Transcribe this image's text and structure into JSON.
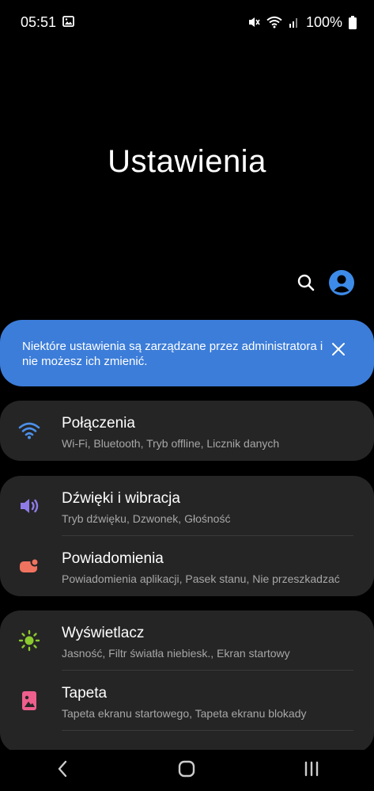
{
  "status_bar": {
    "time": "05:51",
    "battery": "100%",
    "icons": [
      "gallery-notification-icon",
      "mute-icon",
      "wifi-icon",
      "signal-icon",
      "battery-icon"
    ]
  },
  "header": {
    "title": "Ustawienia"
  },
  "banner": {
    "text": "Niektóre ustawienia są zarządzane przez administratora i nie możesz ich zmienić."
  },
  "groups": [
    {
      "items": [
        {
          "title": "Połączenia",
          "subtitle": "Wi-Fi, Bluetooth, Tryb offline, Licznik danych",
          "icon": "wifi-icon",
          "color": "#4C8FEA"
        }
      ]
    },
    {
      "items": [
        {
          "title": "Dźwięki i wibracja",
          "subtitle": "Tryb dźwięku, Dzwonek, Głośność",
          "icon": "volume-icon",
          "color": "#8F7BE8"
        },
        {
          "title": "Powiadomienia",
          "subtitle": "Powiadomienia aplikacji, Pasek stanu, Nie przeszkadzać",
          "icon": "notification-icon",
          "color": "#F0735F"
        }
      ]
    },
    {
      "items": [
        {
          "title": "Wyświetlacz",
          "subtitle": "Jasność, Filtr światła niebiesk., Ekran startowy",
          "icon": "brightness-icon",
          "color": "#8CCB2E"
        },
        {
          "title": "Tapeta",
          "subtitle": "Tapeta ekranu startowego, Tapeta ekranu blokady",
          "icon": "wallpaper-icon",
          "color": "#EE5F8E"
        }
      ]
    }
  ],
  "colors": {
    "background": "#000000",
    "card": "#252525",
    "banner": "#3C7DD9",
    "profile": "#3D8BE8"
  }
}
